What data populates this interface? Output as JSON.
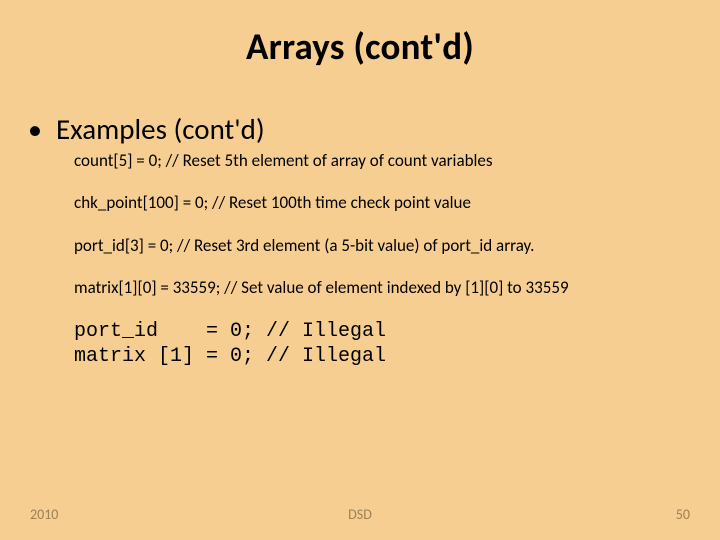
{
  "title": "Arrays (cont'd)",
  "subhead_bullet": "•",
  "subhead": "Examples (cont'd)",
  "examples": {
    "e1": "count[5] = 0; // Reset 5th element of array of count variables",
    "e2": "chk_point[100] = 0; // Reset 100th time check point value",
    "e3": "port_id[3] = 0; // Reset 3rd element (a 5-bit value) of port_id array.",
    "e4": "matrix[1][0] = 33559; // Set value of element indexed by [1][0] to 33559"
  },
  "illegal_block": "port_id    = 0; // Illegal\nmatrix [1] = 0; // Illegal",
  "footer": {
    "left": "2010",
    "center": "DSD",
    "right": "50"
  }
}
